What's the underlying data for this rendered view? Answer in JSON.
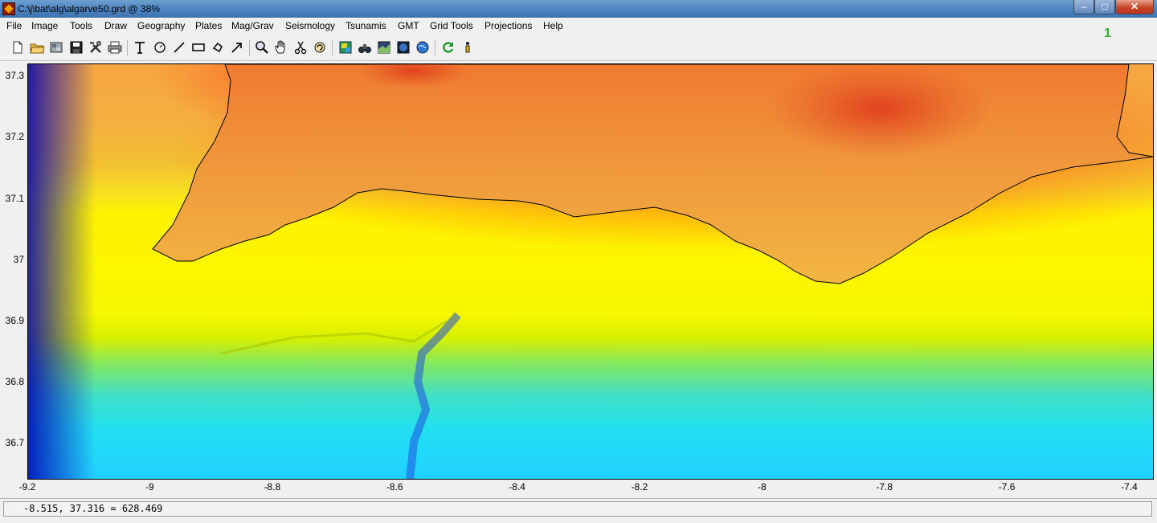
{
  "window": {
    "title": "C:\\j\\bat\\alg\\algarve50.grd  @  38%",
    "minimize_glyph": "–",
    "maximize_glyph": "□",
    "close_glyph": "✕"
  },
  "menu": [
    "File",
    "Image",
    "Tools",
    "Draw",
    "Geography",
    "Plates",
    "Mag/Grav",
    "Seismology",
    "Tsunamis",
    "GMT",
    "Grid Tools",
    "Projections",
    "Help"
  ],
  "toolbar": {
    "icons": [
      "new-file-icon",
      "open-folder-icon",
      "import-image-icon",
      "save-icon",
      "tools-icon",
      "print-icon",
      "text-icon",
      "circle-icon",
      "line-icon",
      "rectangle-icon",
      "polygon-icon",
      "arrow-icon",
      "zoom-icon",
      "pan-hand-icon",
      "cut-icon",
      "rotate-icon",
      "shade-icon",
      "binoculars-icon",
      "grid-image-icon",
      "globe-dark-icon",
      "globe-icon",
      "refresh-icon",
      "info-icon"
    ]
  },
  "figure_number": "1",
  "colors": {
    "plot_border": "#000000",
    "coastline": "#000000",
    "figure_number": "#2bb52b"
  },
  "axes": {
    "x_ticks": [
      "-9.2",
      "-9",
      "-8.8",
      "-8.6",
      "-8.4",
      "-8.2",
      "-8",
      "-7.8",
      "-7.6",
      "-7.4"
    ],
    "x_tick_values": [
      -9.2,
      -9.0,
      -8.8,
      -8.6,
      -8.4,
      -8.2,
      -8.0,
      -7.8,
      -7.6,
      -7.4
    ],
    "y_ticks": [
      "37.3",
      "37.2",
      "37.1",
      "37",
      "36.9",
      "36.8",
      "36.7"
    ],
    "y_tick_values": [
      37.3,
      37.2,
      37.1,
      37.0,
      36.9,
      36.8,
      36.7
    ],
    "x_range": [
      -9.2,
      -7.36
    ],
    "y_range": [
      36.64,
      37.32
    ]
  },
  "status": {
    "readout": "-8.515, 37.316 = 628.469"
  }
}
